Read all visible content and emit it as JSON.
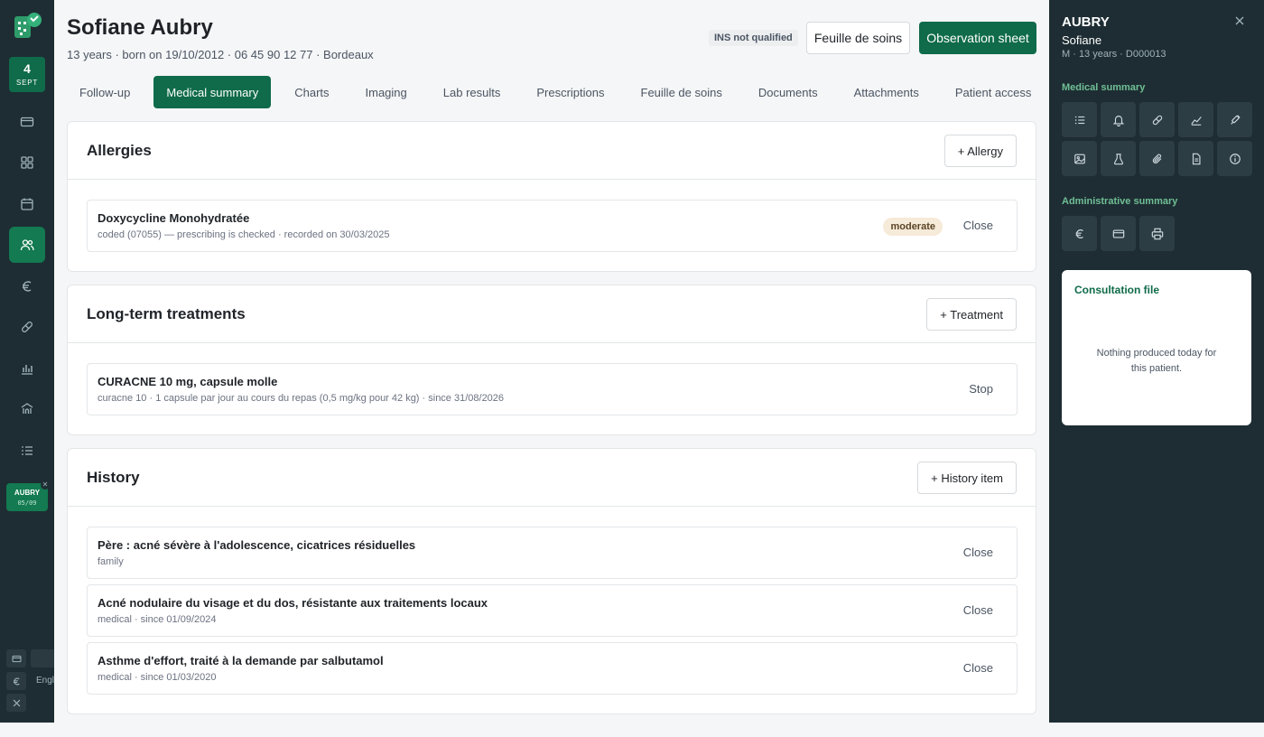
{
  "rail": {
    "date_day": "4",
    "date_month": "SEPT",
    "nav_icons": [
      "card-icon",
      "grid-icon",
      "calendar-icon",
      "users-icon",
      "euro-icon",
      "pill-icon",
      "bar-chart-icon",
      "bank-icon",
      "list-icon"
    ],
    "active_item": "users-icon",
    "open_patient": {
      "name": "AUBRY",
      "date": "05/09"
    },
    "language_label": "English"
  },
  "header": {
    "patient_name": "Sofiane Aubry",
    "patient_info": "13 years · born on 19/10/2012 · 06 45 90 12 77 · Bordeaux",
    "ins_status": "INS not qualified",
    "feuille_button": "Feuille de soins",
    "observation_button": "Observation sheet"
  },
  "tabs": [
    {
      "label": "Follow-up",
      "active": false
    },
    {
      "label": "Medical summary",
      "active": true
    },
    {
      "label": "Charts",
      "active": false
    },
    {
      "label": "Imaging",
      "active": false
    },
    {
      "label": "Lab results",
      "active": false
    },
    {
      "label": "Prescriptions",
      "active": false
    },
    {
      "label": "Feuille de soins",
      "active": false
    },
    {
      "label": "Documents",
      "active": false
    },
    {
      "label": "Attachments",
      "active": false
    },
    {
      "label": "Patient access",
      "active": false
    }
  ],
  "allergies": {
    "title": "Allergies",
    "add_button": "+ Allergy",
    "items": [
      {
        "name": "Doxycycline Monohydratée",
        "detail": "coded (07055) — prescribing is checked · recorded on 30/03/2025",
        "severity": "moderate",
        "action": "Close"
      }
    ]
  },
  "treatments": {
    "title": "Long-term treatments",
    "add_button": "+ Treatment",
    "items": [
      {
        "name": "CURACNE 10 mg, capsule molle",
        "detail": "curacne 10 · 1 capsule par jour au cours du repas (0,5 mg/kg pour 42 kg) · since 31/08/2026",
        "action": "Stop"
      }
    ]
  },
  "history": {
    "title": "History",
    "add_button": "+ History item",
    "items": [
      {
        "name": "Père : acné sévère à l'adolescence, cicatrices résiduelles",
        "detail": "family",
        "action": "Close"
      },
      {
        "name": "Acné nodulaire du visage et du dos, résistante aux traitements locaux",
        "detail": "medical · since 01/09/2024",
        "action": "Close"
      },
      {
        "name": "Asthme d'effort, traité à la demande par salbutamol",
        "detail": "medical · since 01/03/2020",
        "action": "Close"
      }
    ]
  },
  "panel": {
    "last_name": "AUBRY",
    "first_name": "Sofiane",
    "meta": "M · 13 years · D000013",
    "medical_summary_label": "Medical summary",
    "medical_icons": [
      "list-icon",
      "bell-icon",
      "pill-icon",
      "line-chart-icon",
      "syringe-icon",
      "image-icon",
      "flask-icon",
      "paperclip-icon",
      "document-icon",
      "info-icon"
    ],
    "administrative_summary_label": "Administrative summary",
    "admin_icons": [
      "euro-icon",
      "card-icon",
      "printer-icon"
    ],
    "consultation_title": "Consultation file",
    "consultation_empty": "Nothing produced today for this patient."
  },
  "colors": {
    "primary": "#0f6b4a",
    "rail_bg": "#1e2d33",
    "panel_accent": "#6fbf95",
    "severity_bg": "#f6ead9"
  }
}
